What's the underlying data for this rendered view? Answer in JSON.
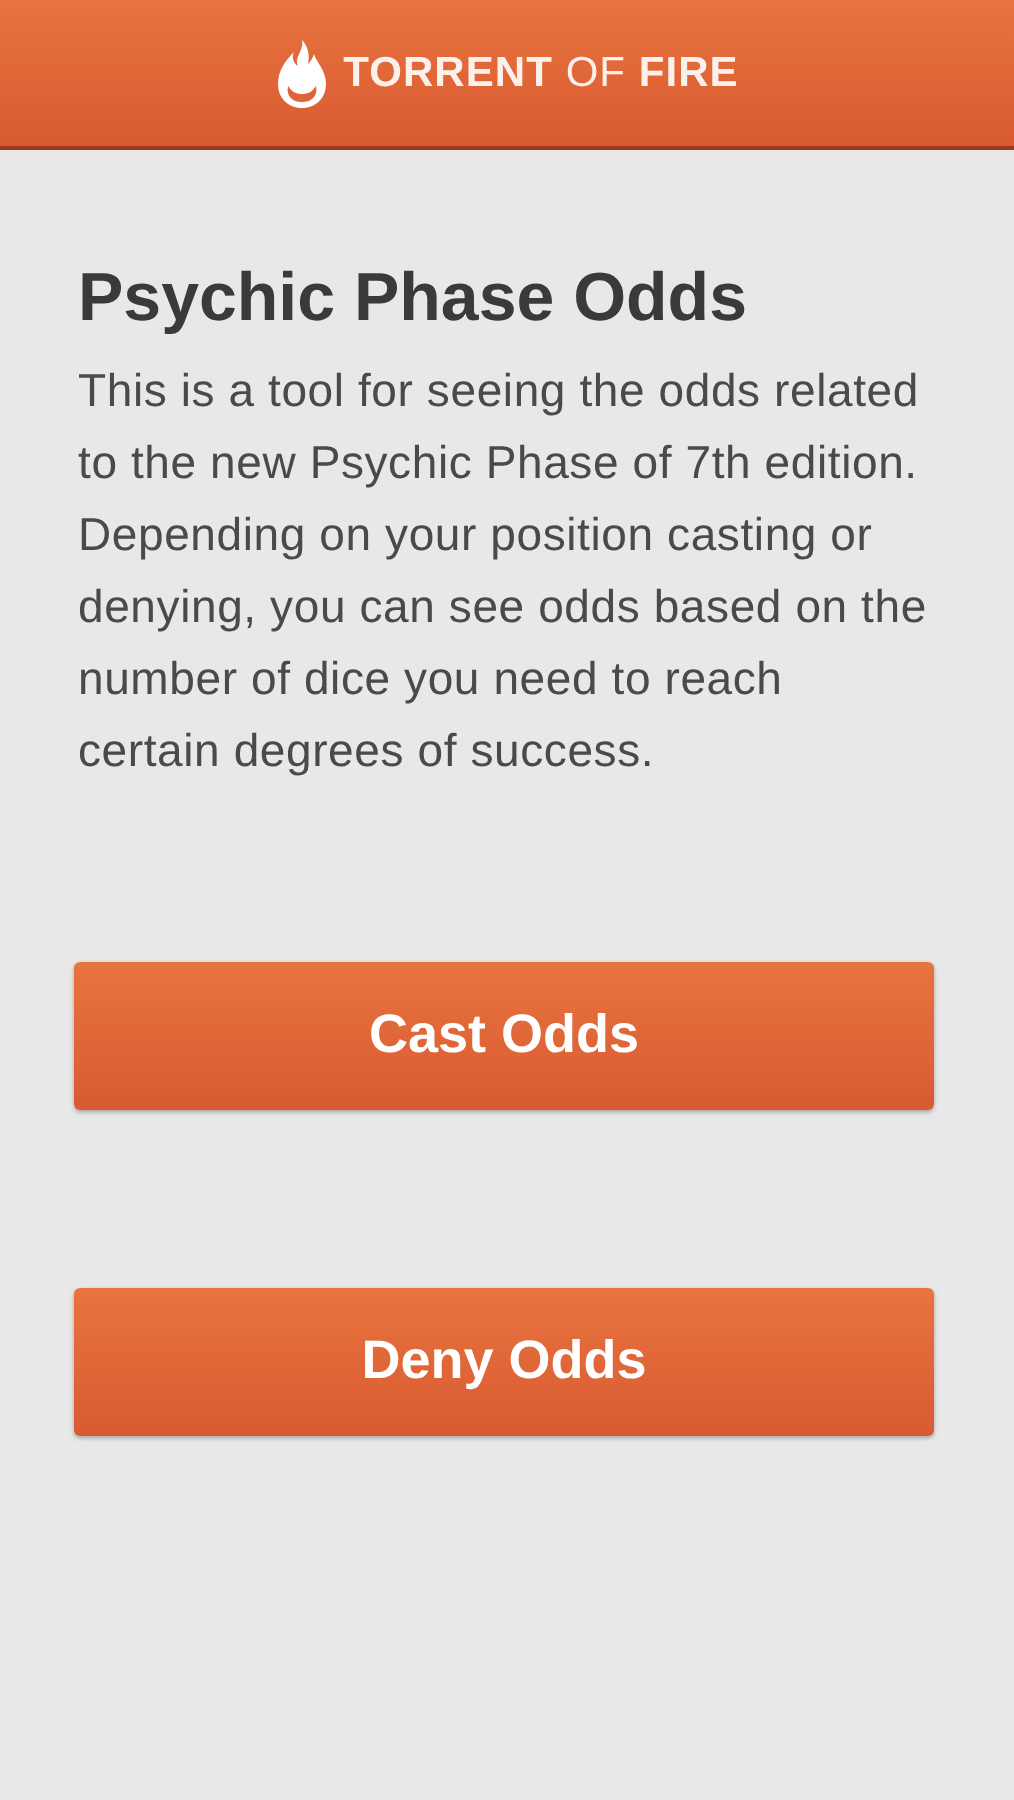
{
  "header": {
    "logo": "**TORRENT** OF **FIRE**"
  },
  "title": "Psychic Phase Odds",
  "description": "This is a tool for seeing the odds related to the new Psychic Phase of 7th edition. Depending on your position casting or denying, you can see odds based on the number of dice you need to reach certain degrees of success.",
  "buttons": [
    {
      "label": "Cast Odds"
    },
    {
      "label": "Deny Odds"
    }
  ]
}
